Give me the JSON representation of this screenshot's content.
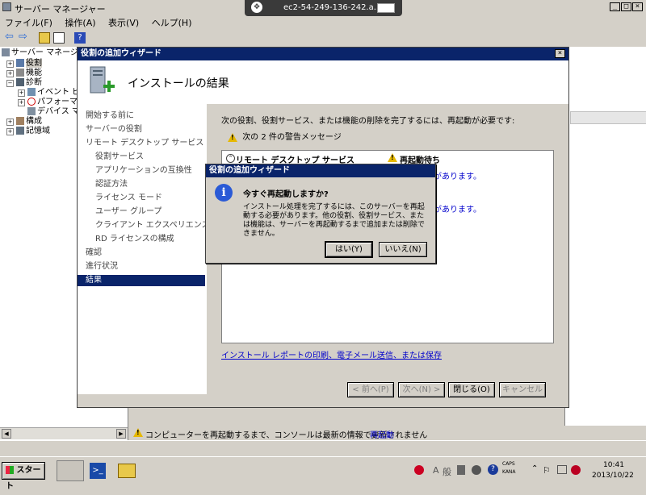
{
  "main_window": {
    "title": "サーバー マネージャー"
  },
  "rdp_bar": {
    "host": "ec2-54-249-136-242.a..."
  },
  "menu": [
    "ファイル(F)",
    "操作(A)",
    "表示(V)",
    "ヘルプ(H)"
  ],
  "tree": {
    "root": "サーバー マネージャ",
    "items": [
      "役割",
      "機能",
      "診断",
      "イベント ビュ",
      "パフォーマン",
      "デバイス マネ",
      "構成",
      "記憶域"
    ]
  },
  "wizard": {
    "title": "役割の追加ウィザード",
    "heading": "インストールの結果",
    "steps": [
      {
        "label": "開始する前に",
        "level": 0
      },
      {
        "label": "サーバーの役割",
        "level": 0
      },
      {
        "label": "リモート デスクトップ サービス",
        "level": 0
      },
      {
        "label": "役割サービス",
        "level": 1
      },
      {
        "label": "アプリケーションの互換性",
        "level": 1
      },
      {
        "label": "認証方法",
        "level": 1
      },
      {
        "label": "ライセンス モード",
        "level": 1
      },
      {
        "label": "ユーザー グループ",
        "level": 1
      },
      {
        "label": "クライアント エクスペリエンス",
        "level": 1
      },
      {
        "label": "RD ライセンスの構成",
        "level": 1
      },
      {
        "label": "確認",
        "level": 0
      },
      {
        "label": "進行状況",
        "level": 0
      },
      {
        "label": "結果",
        "level": 0,
        "active": true
      }
    ],
    "message": "次の役割、役割サービス、または機能の削除を完了するには、再起動が必要です:",
    "warning_count": "次の 2 件の警告メッセージ",
    "item_name": "リモート デスクトップ サービス",
    "item_status": "再起動待ち",
    "item_detail_1": "があります。",
    "item_detail_2": "があります。",
    "report_link": "インストール レポートの印刷、電子メール送信、または保存",
    "buttons": {
      "prev": "< 前へ(P)",
      "next": "次へ(N) >",
      "close": "閉じる(O)",
      "cancel": "キャンセル"
    }
  },
  "dialog": {
    "title": "役割の追加ウィザード",
    "question": "今すぐ再起動しますか?",
    "body": "インストール処理を完了するには、このサーバーを再起動する必要があります。他の役割、役割サービス、または機能は、サーバーを再起動するまで追加または削除できません。",
    "yes": "はい(Y)",
    "no": "いいえ(N)"
  },
  "status": {
    "message": "コンピューターを再起動するまで、コンソールは最新の情報で更新されません",
    "link": "再起動"
  },
  "taskbar": {
    "start": "スタート",
    "tray_time": "10:41",
    "tray_date": "2013/10/22",
    "tray_caps": "CAPS",
    "tray_kana": "KANA",
    "ime_a": "A",
    "ime_han": "般"
  }
}
